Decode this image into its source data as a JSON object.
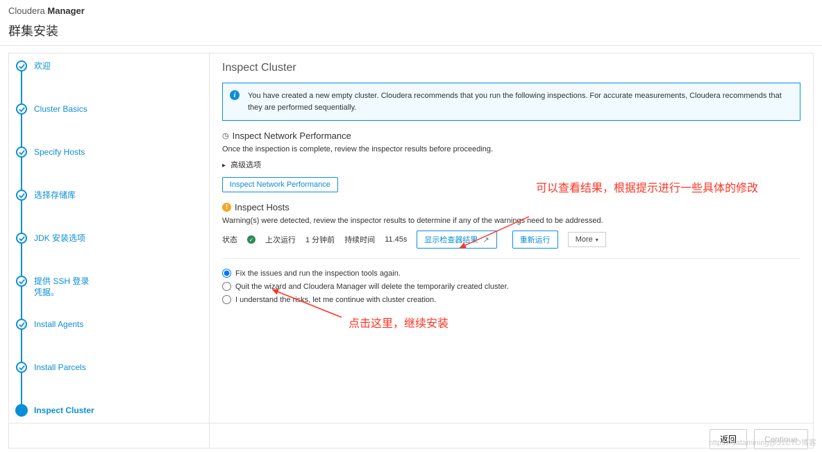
{
  "header": {
    "brand_light": "Cloudera",
    "brand_bold": "Manager"
  },
  "page_title": "群集安装",
  "steps": [
    {
      "label": "欢迎"
    },
    {
      "label": "Cluster Basics"
    },
    {
      "label": "Specify Hosts"
    },
    {
      "label": "选择存储库"
    },
    {
      "label": "JDK 安装选项"
    },
    {
      "label": "提供 SSH 登录凭据。"
    },
    {
      "label": "Install Agents"
    },
    {
      "label": "Install Parcels"
    },
    {
      "label": "Inspect Cluster"
    }
  ],
  "content": {
    "title": "Inspect Cluster",
    "info_text": "You have created a new empty cluster. Cloudera recommends that you run the following inspections. For accurate measurements, Cloudera recommends that they are performed sequentially.",
    "section1_title": "Inspect Network Performance",
    "section1_sub": "Once the inspection is complete, review the inspector results before proceeding.",
    "advanced_label": "高级选项",
    "inspect_network_btn": "Inspect Network Performance",
    "section2_title": "Inspect Hosts",
    "section2_sub": "Warning(s) were detected, review the inspector results to determine if any of the warnings need to be addressed.",
    "status_label": "状态",
    "last_run_label": "上次运行",
    "last_run_value": "1 分钟前",
    "duration_label": "持续时间",
    "duration_value": "11.45s",
    "show_results_btn": "显示检查器结果",
    "rerun_btn": "重新运行",
    "more_btn": "More",
    "radio1": "Fix the issues and run the inspection tools again.",
    "radio2": "Quit the wizard and Cloudera Manager will delete the temporarily created cluster.",
    "radio3": "I understand the risks, let me continue with cluster creation."
  },
  "annotations": {
    "top": "可以查看结果，根据提示进行一些具体的修改",
    "bottom": "点击这里，继续安装"
  },
  "footer": {
    "back": "返回",
    "continue": "Continue"
  },
  "watermark": "https://datamining@51CTO博客"
}
